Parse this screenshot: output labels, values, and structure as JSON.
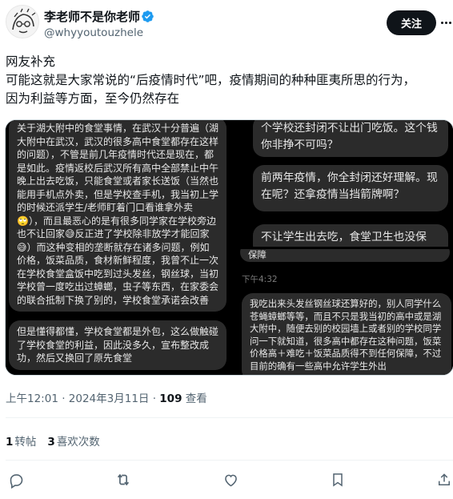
{
  "header": {
    "display_name": "李老师不是你老师",
    "handle": "@whyyoutouzhele",
    "follow_label": "关注"
  },
  "tweet": {
    "lines": [
      "网友补充",
      "可能这就是大家常说的“后疫情时代”吧，疫情期间的种种匪夷所思的行为，",
      "因为利益等方面，至今仍然存在"
    ]
  },
  "media": {
    "left_bubble_1": "关于湖大附中的食堂事情，在武汉十分普遍（湖大附中在武汉，武汉的很多高中食堂都存在这样的问题），不管是前几年疫情时代还是现在，都是如此。疫情返校后武汉所有高中全部禁止中午晚上出去吃饭，只能食堂或者家长送饭（当然也能用手机点外卖，但是学校查手机，我当初上学的时候还派学生/老师盯着门口看谁拿外卖🙄），而且最恶心的是有很多同学家在学校旁边也不让回家😅反正进了学校除非放学才能回家😅）而这种变相的垄断就存在诸多问题，例如价格，饭菜品质，食材新鲜程度，我曾不止一次在学校食堂盒饭中吃到过头发丝，钢丝球，当初学校曾一度吃出过蟑螂，虫子等东西，在家委会的联合抵制下换了别的，学校食堂承诺会改善",
    "left_bubble_2": "但是懂得都懂，学校食堂都是外包，这么做触碰了学校食堂的利益，因此没多久，宣布整改成功，然后又换回了原先食堂",
    "rt_bubble_1": "个学校还封闭不让出门吃饭。这个钱你非挣不可吗？",
    "rt_bubble_2": "前两年疫情，你全封闭还好理解。现在呢？还拿疫情当挡箭牌啊？",
    "rt_bubble_3": "不让学生出去吃，食堂卫生也没保",
    "rb_bubble_top": "保障",
    "rb_timestamp": "下午4:32",
    "rb_bubble_2": "我吃出来头发丝钢丝球还算好的，别人同学什么苍蝇蟑螂等等，而且不只是我当初的高中或是湖大附中，随便去别的校园墙上或者别的学校同学问一下就知道，很多高中都存在这种问题，饭菜价格高＋难吃＋饭菜品质得不到任何保障，不过目前的确有一些高中允许学生外出"
  },
  "meta": {
    "time": "上午12:01 · 2024年3月11日 · ",
    "views_count": "109",
    "views_label": " 查看"
  },
  "stats": {
    "retweets_count": "1",
    "retweets_label": "转帖",
    "quotes_count": "3",
    "quotes_label": "喜欢次数"
  },
  "icons": {
    "reply": "reply-icon",
    "retweet": "retweet-icon",
    "like": "heart-icon",
    "bookmark": "bookmark-icon",
    "share": "share-icon"
  },
  "colors": {
    "verified": "#1d9bf0",
    "follow_bg": "#0f1419",
    "bubble": "#2b2b2b"
  }
}
